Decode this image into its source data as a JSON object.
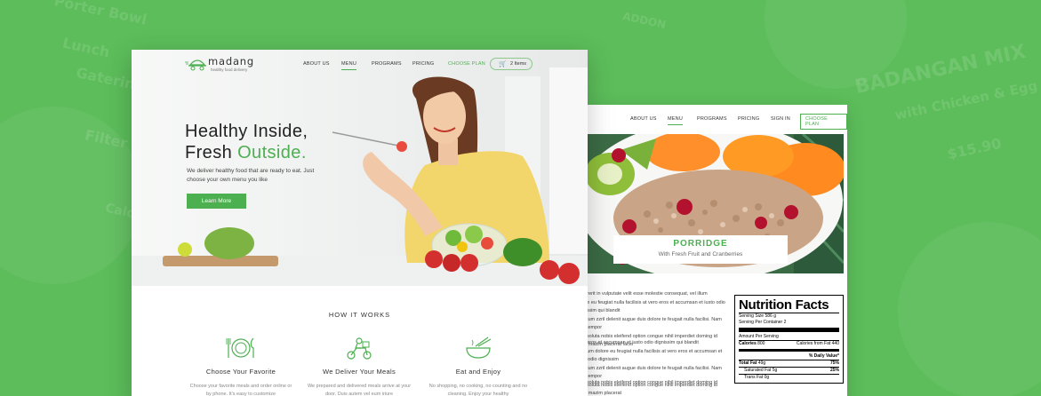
{
  "background": {
    "ghost_texts": [
      "Porter Bowl",
      "Lunch",
      "Gatering",
      "Filter by",
      "Caloric",
      "ADDON",
      "BADANGAN MIX",
      "with Chicken & Egg",
      "$15.90"
    ]
  },
  "left_page": {
    "brand": {
      "name": "madang",
      "tagline": "healthy food delivery"
    },
    "nav": {
      "items": [
        "ABOUT US",
        "MENU",
        "PROGRAMS",
        "PRICING",
        "CHOOSE PLAN"
      ],
      "active": "MENU",
      "cart_label": "2 Items"
    },
    "hero": {
      "headline_line1": "Healthy Inside,",
      "headline_line2_a": "Fresh ",
      "headline_line2_b": "Outside.",
      "subcopy": "We deliver healthy food that are ready to eat. Just choose your own menu you like",
      "cta": "Learn More"
    },
    "how_it_works": {
      "title": "HOW IT WORKS",
      "steps": [
        {
          "icon": "plate-utensils-icon",
          "title": "Choose Your Favorite",
          "desc": "Choose your favorite meals and order online or by phone. It's easy to customize"
        },
        {
          "icon": "delivery-scooter-icon",
          "title": "We Deliver Your Meals",
          "desc": "We prepared and delivered meals arrive at your door. Duis autem vel eum iriure"
        },
        {
          "icon": "bowl-chopsticks-icon",
          "title": "Eat and Enjoy",
          "desc": "No shopping, no cooking, no counting and no cleaning. Enjoy your healthy"
        }
      ]
    }
  },
  "right_page": {
    "nav": {
      "items": [
        "ABOUT US",
        "MENU",
        "PROGRAMS",
        "PRICING",
        "SIGN IN",
        "CHOOSE PLAN"
      ],
      "active": "MENU"
    },
    "dish": {
      "name": "PORRIDGE",
      "subtitle": "With Fresh Fruit and Cranberries"
    },
    "paragraphs": [
      "hendrerit in vulputate velit esse molestie consequat, vel illum\ndolore eu feugiat nulla facilisis at vero eros et accumsan et iusto odio dignissim qui blandit\nluptatum zzril delenit augue duis dolore te feugait nulla facilisi. Nam liber tempor\ncum soluta nobis eleifend option congue nihil imperdiet doming id quod mazim placerat facer",
      "vero eros et accumsan et iusto odio dignissim qui blandit\nvel illum dolore eu feugiat nulla facilisis at vero eros et accumsan et iusto odio dignissim\nluptatum zzril delenit augue duis dolore te feugait nulla facilisi. Nam liber tempor\ncum soluta nobis eleifend option congue nihil imperdiet doming id quod mazim placerat",
      "cum soluta nobis eleifend option congue nihil imperdiet doming id quod"
    ],
    "nutrition": {
      "title": "Nutrition Facts",
      "serving_size": "Serving Size 586 g",
      "servings": "Serving Per Container 2",
      "amount_per_serving": "Amount Per Serving",
      "calories_label": "Calories",
      "calories_value": "800",
      "calories_fat": "Calories from Fat 440",
      "daily_value": "% Daily Value*",
      "rows": [
        {
          "label": "Total Fat",
          "amount": "49g",
          "pct": "75%",
          "bold": true
        },
        {
          "label": "Saturated Fat",
          "amount": "5g",
          "pct": "25%",
          "bold": false
        },
        {
          "label": "Trans Fat",
          "amount": "0g",
          "pct": "",
          "bold": false
        }
      ]
    }
  }
}
